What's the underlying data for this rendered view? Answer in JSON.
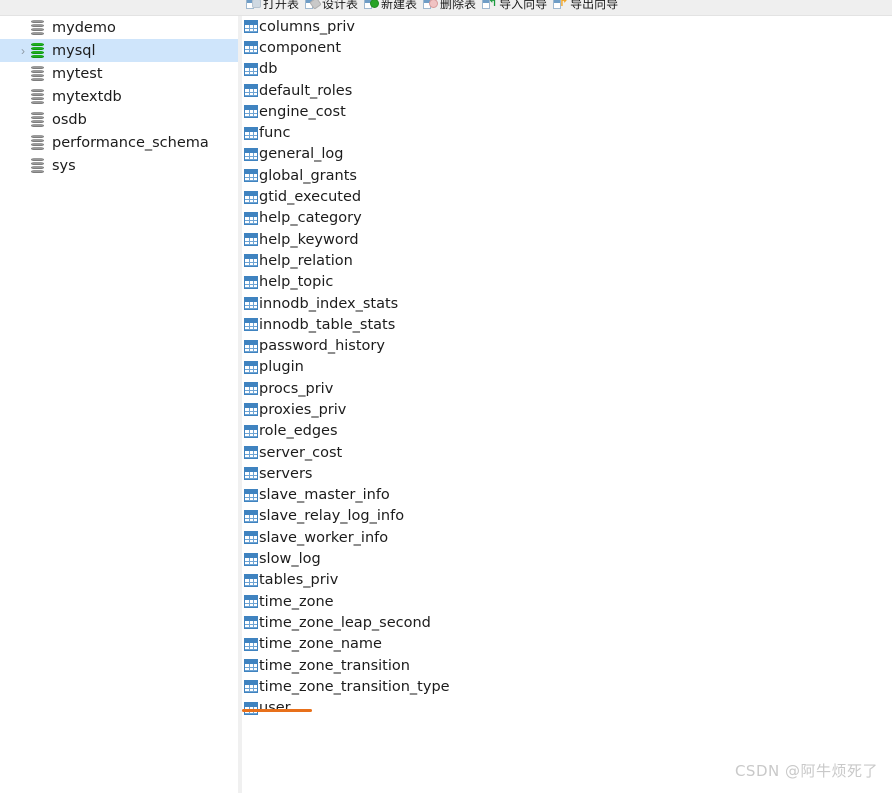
{
  "toolbar": {
    "items": [
      {
        "label": "打开表",
        "icon": "open-table-icon",
        "badge": "badge-open",
        "glyph": ""
      },
      {
        "label": "设计表",
        "icon": "design-table-icon",
        "badge": "badge-design",
        "glyph": ""
      },
      {
        "label": "新建表",
        "icon": "new-table-icon",
        "badge": "badge-new",
        "glyph": ""
      },
      {
        "label": "删除表",
        "icon": "delete-table-icon",
        "badge": "badge-del",
        "glyph": ""
      },
      {
        "label": "导入向导",
        "icon": "import-wizard-icon",
        "badge": "badge-in",
        "glyph": "↰"
      },
      {
        "label": "导出向导",
        "icon": "export-wizard-icon",
        "badge": "badge-out",
        "glyph": "↱"
      }
    ]
  },
  "sidebar": {
    "databases": [
      {
        "label": "mydemo",
        "selected": false,
        "expandable": false,
        "icon": "database-icon"
      },
      {
        "label": "mysql",
        "selected": true,
        "expandable": true,
        "icon": "database-icon-active"
      },
      {
        "label": "mytest",
        "selected": false,
        "expandable": false,
        "icon": "database-icon"
      },
      {
        "label": "mytextdb",
        "selected": false,
        "expandable": false,
        "icon": "database-icon"
      },
      {
        "label": "osdb",
        "selected": false,
        "expandable": false,
        "icon": "database-icon"
      },
      {
        "label": "performance_schema",
        "selected": false,
        "expandable": false,
        "icon": "database-icon"
      },
      {
        "label": "sys",
        "selected": false,
        "expandable": false,
        "icon": "database-icon"
      }
    ],
    "chevron_glyph": "›"
  },
  "tables_panel": {
    "tables": [
      "columns_priv",
      "component",
      "db",
      "default_roles",
      "engine_cost",
      "func",
      "general_log",
      "global_grants",
      "gtid_executed",
      "help_category",
      "help_keyword",
      "help_relation",
      "help_topic",
      "innodb_index_stats",
      "innodb_table_stats",
      "password_history",
      "plugin",
      "procs_priv",
      "proxies_priv",
      "role_edges",
      "server_cost",
      "servers",
      "slave_master_info",
      "slave_relay_log_info",
      "slave_worker_info",
      "slow_log",
      "tables_priv",
      "time_zone",
      "time_zone_leap_second",
      "time_zone_name",
      "time_zone_transition",
      "time_zone_transition_type",
      "user"
    ],
    "annotated_table": "user"
  },
  "watermark": {
    "text": "CSDN @阿牛烦死了"
  },
  "colors": {
    "selection": "#cfe5fb",
    "toolbar_bg": "#efefef",
    "table_icon": "#3f83c0",
    "db_icon_active": "#1fae1f",
    "db_icon": "#9b9b9b",
    "annotation": "#e8701a",
    "watermark": "#c9c9c9"
  }
}
